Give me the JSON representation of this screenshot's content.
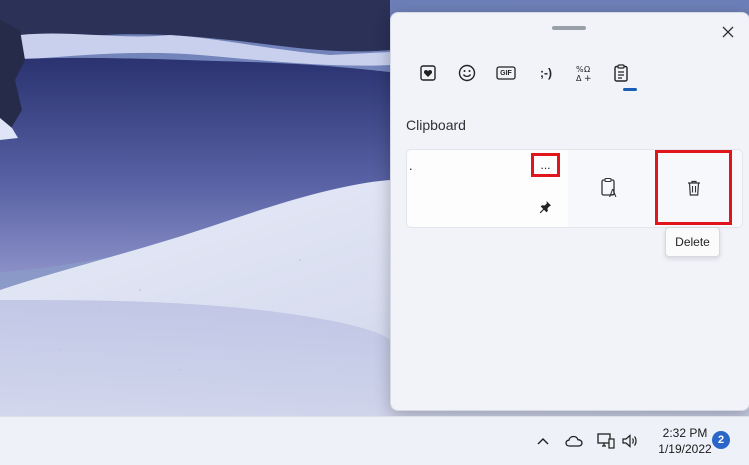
{
  "clipboard_panel": {
    "close_icon": "close-icon",
    "tabs": [
      {
        "name": "emoji-favorites",
        "icon": "heart-note-icon"
      },
      {
        "name": "emoji",
        "icon": "smiley-icon"
      },
      {
        "name": "gif",
        "icon": "gif-icon",
        "label": "GIF"
      },
      {
        "name": "kaomoji",
        "icon": "kaomoji-icon",
        "label": ";-)"
      },
      {
        "name": "symbols",
        "icon": "symbols-icon"
      },
      {
        "name": "clipboard",
        "icon": "clipboard-icon",
        "selected": true
      }
    ],
    "section_title": "Clipboard",
    "item": {
      "text": ".",
      "more_label": "...",
      "pinned": true
    },
    "actions": {
      "paste_as_text_icon": "paste-as-text-icon",
      "delete_icon": "trash-icon",
      "delete_tooltip": "Delete"
    },
    "highlight_color": "#e0161c",
    "accent": "#1a5fb4"
  },
  "taskbar": {
    "time": "2:32 PM",
    "date": "1/19/2022",
    "notification_count": "2",
    "tray_icons": [
      "chevron-up-icon",
      "onedrive-cloud-icon",
      "network-icon",
      "volume-icon"
    ]
  }
}
